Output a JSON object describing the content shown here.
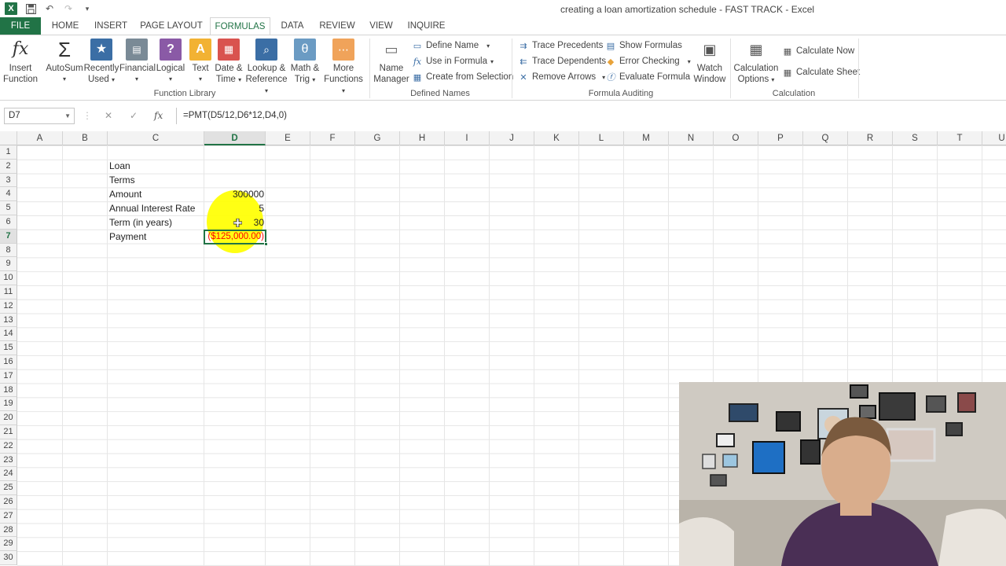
{
  "window": {
    "title": "creating a loan amortization schedule - FAST TRACK - Excel"
  },
  "tabs": [
    {
      "label": "FILE"
    },
    {
      "label": "HOME"
    },
    {
      "label": "INSERT"
    },
    {
      "label": "PAGE LAYOUT"
    },
    {
      "label": "FORMULAS"
    },
    {
      "label": "DATA"
    },
    {
      "label": "REVIEW"
    },
    {
      "label": "VIEW"
    },
    {
      "label": "INQUIRE"
    }
  ],
  "ribbon": {
    "insert_function": {
      "line1": "Insert",
      "line2": "Function",
      "icon": "fx-icon"
    },
    "function_library": {
      "label": "Function Library",
      "buttons": [
        {
          "line1": "AutoSum",
          "line2": "",
          "icon": "sigma-icon"
        },
        {
          "line1": "Recently",
          "line2": "Used",
          "icon": "star-icon"
        },
        {
          "line1": "Financial",
          "line2": "",
          "icon": "financial-icon"
        },
        {
          "line1": "Logical",
          "line2": "",
          "icon": "question-icon"
        },
        {
          "line1": "Text",
          "line2": "",
          "icon": "text-icon"
        },
        {
          "line1": "Date &",
          "line2": "Time",
          "icon": "calendar-icon"
        },
        {
          "line1": "Lookup &",
          "line2": "Reference",
          "icon": "magnifier-icon"
        },
        {
          "line1": "Math &",
          "line2": "Trig",
          "icon": "theta-icon"
        },
        {
          "line1": "More",
          "line2": "Functions",
          "icon": "more-icon"
        }
      ]
    },
    "defined_names": {
      "label": "Defined Names",
      "name_manager": {
        "line1": "Name",
        "line2": "Manager"
      },
      "items": [
        "Define Name",
        "Use in Formula",
        "Create from Selection"
      ]
    },
    "formula_auditing": {
      "label": "Formula Auditing",
      "left_items": [
        "Trace Precedents",
        "Trace Dependents",
        "Remove Arrows"
      ],
      "right_items": [
        "Show Formulas",
        "Error Checking",
        "Evaluate Formula"
      ],
      "watch_window": {
        "line1": "Watch",
        "line2": "Window"
      }
    },
    "calculation": {
      "label": "Calculation",
      "options": {
        "line1": "Calculation",
        "line2": "Options"
      },
      "items": [
        "Calculate Now",
        "Calculate Sheet"
      ]
    }
  },
  "formula_bar": {
    "name_box": "D7",
    "formula": "=PMT(D5/12,D6*12,D4,0)"
  },
  "columns": [
    "A",
    "B",
    "C",
    "D",
    "E",
    "F",
    "G",
    "H",
    "I",
    "J",
    "K",
    "L",
    "M",
    "N",
    "O",
    "P",
    "Q",
    "R",
    "S",
    "T",
    "U"
  ],
  "rows": [
    "1",
    "2",
    "3",
    "4",
    "5",
    "6",
    "7",
    "8",
    "9",
    "10",
    "11",
    "12",
    "13",
    "14",
    "15",
    "16",
    "17",
    "18",
    "19",
    "20",
    "21",
    "22",
    "23",
    "24",
    "25",
    "26",
    "27",
    "28",
    "29",
    "30"
  ],
  "sheet": {
    "c2": "Loan",
    "c3": "Terms",
    "c4": "Amount",
    "c5": "Annual Interest Rate",
    "c6": "Term (in years)",
    "c7": "Payment",
    "d4": "300000",
    "d5": "5",
    "d6": "30",
    "d7": "($125,000.00)"
  },
  "colors": {
    "excel_green": "#217346",
    "negative_red": "#ff0000",
    "highlight_yellow": "#ffff00"
  }
}
